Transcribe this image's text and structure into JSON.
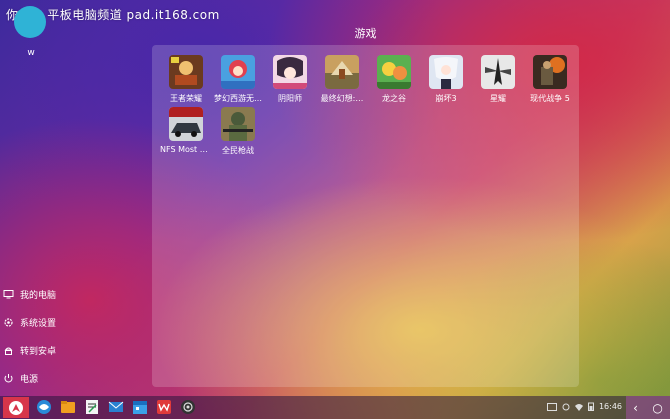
{
  "watermark": {
    "text": "你的 • 平板电脑频道 pad.it168.com"
  },
  "user": {
    "name": "w"
  },
  "panel": {
    "title": "游戏",
    "apps": [
      {
        "label": "王者荣耀",
        "icon": "honor-of-kings-icon"
      },
      {
        "label": "梦幻西游无…",
        "icon": "fantasy-westward-icon"
      },
      {
        "label": "阴阳师",
        "icon": "onmyoji-icon"
      },
      {
        "label": "最终幻想:…",
        "icon": "final-fantasy-icon"
      },
      {
        "label": "龙之谷",
        "icon": "dragon-nest-icon"
      },
      {
        "label": "崩坏3",
        "icon": "honkai-3-icon"
      },
      {
        "label": "星耀",
        "icon": "xingyao-icon"
      },
      {
        "label": "现代战争 5",
        "icon": "modern-combat-5-icon"
      },
      {
        "label": "NFS Most W…",
        "icon": "nfs-most-wanted-icon"
      },
      {
        "label": "全民枪战",
        "icon": "quanmin-qiangzhan-icon"
      }
    ]
  },
  "side_menu": [
    {
      "label": "我的电脑",
      "icon": "computer-icon"
    },
    {
      "label": "系统设置",
      "icon": "gear-icon"
    },
    {
      "label": "转到安卓",
      "icon": "android-icon"
    },
    {
      "label": "电源",
      "icon": "power-icon"
    }
  ],
  "taskbar": {
    "apps": [
      "browser-icon",
      "file-manager-icon",
      "notes-icon",
      "mail-icon",
      "calendar-icon",
      "wps-office-icon",
      "camera-icon"
    ],
    "time": "16:46",
    "tray_icons": [
      "keyboard-icon",
      "bluetooth-icon",
      "wifi-icon",
      "battery-icon"
    ]
  },
  "colors": {
    "accent": "#d7354a",
    "avatar": "#2fb3d6"
  }
}
